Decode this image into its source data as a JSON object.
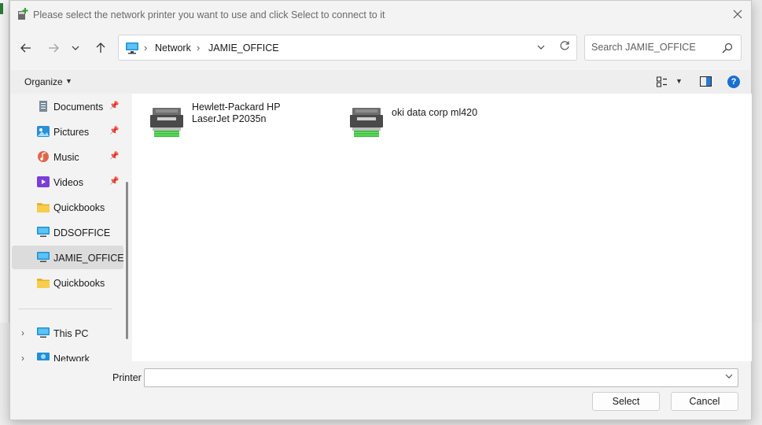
{
  "window": {
    "title": "Please select the network printer you want to use and click Select to connect to it"
  },
  "nav": {
    "back": "back",
    "forward": "forward",
    "recent": "recent-locations",
    "up": "up"
  },
  "address": {
    "breadcrumb": [
      "Network",
      "JAMIE_OFFICE"
    ]
  },
  "search": {
    "placeholder": "Search JAMIE_OFFICE"
  },
  "toolbar": {
    "organize_label": "Organize"
  },
  "sidebar": {
    "items": [
      {
        "label": "Documents",
        "icon": "documents-icon",
        "pinned": true
      },
      {
        "label": "Pictures",
        "icon": "pictures-icon",
        "pinned": true
      },
      {
        "label": "Music",
        "icon": "music-icon",
        "pinned": true
      },
      {
        "label": "Videos",
        "icon": "videos-icon",
        "pinned": true
      },
      {
        "label": "Quickbooks",
        "icon": "folder-icon",
        "pinned": false
      },
      {
        "label": "DDSOFFICE",
        "icon": "computer-icon",
        "pinned": false
      },
      {
        "label": "JAMIE_OFFICE",
        "icon": "computer-icon",
        "pinned": false,
        "selected": true
      },
      {
        "label": "Quickbooks",
        "icon": "folder-icon",
        "pinned": false
      }
    ],
    "tree": [
      {
        "label": "This PC",
        "icon": "this-pc-icon"
      },
      {
        "label": "Network",
        "icon": "network-icon"
      }
    ]
  },
  "printers": [
    {
      "name": "Hewlett-Packard HP LaserJet P2035n"
    },
    {
      "name": "oki data corp ml420"
    }
  ],
  "form": {
    "printer_label": "Printer",
    "printer_value": "",
    "select_label": "Select",
    "cancel_label": "Cancel"
  },
  "colors": {
    "accent": "#1a6fd1",
    "folder": "#f2c744",
    "printer_green": "#3cc43c"
  }
}
